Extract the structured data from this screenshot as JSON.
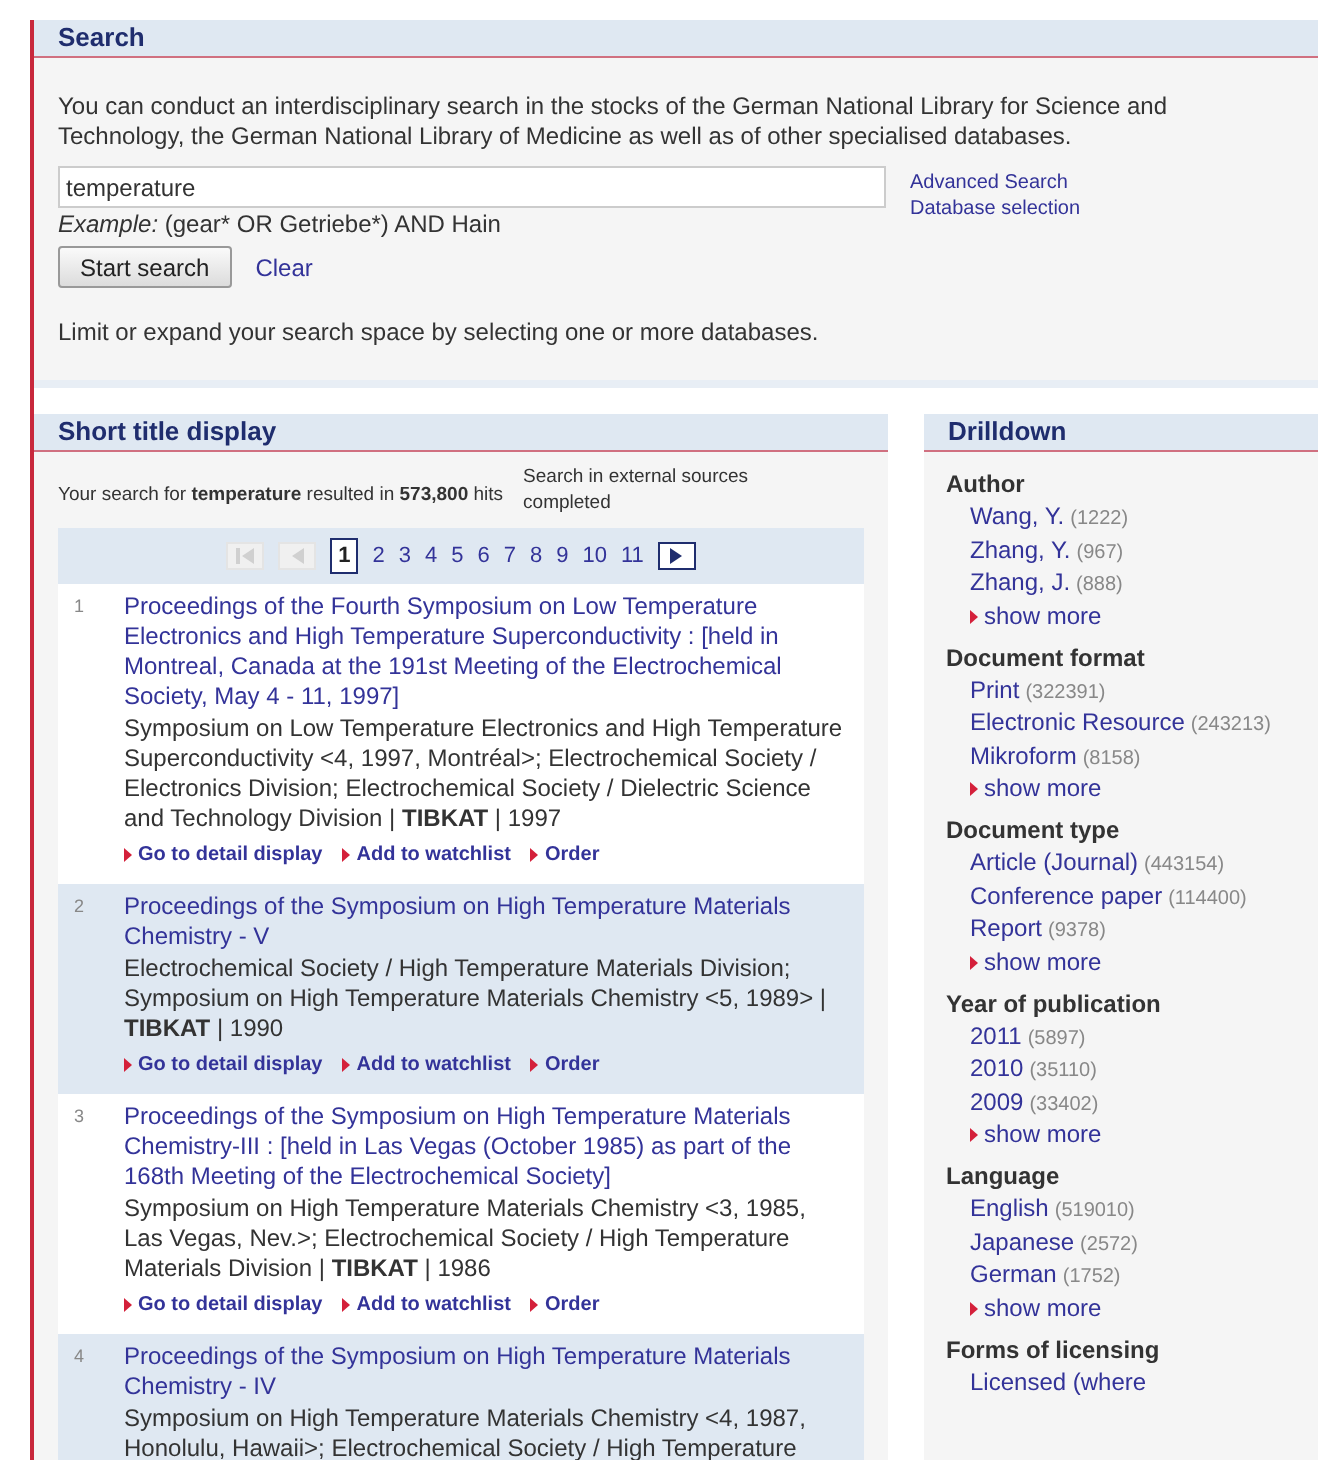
{
  "search": {
    "title": "Search",
    "intro": "You can conduct an interdisciplinary search in the stocks of the German National Library for Science and Technology, the German National Library of Medicine as well as of other specialised databases.",
    "query": "temperature",
    "example_label": "Example:",
    "example": "(gear* OR Getriebe*) AND Hain",
    "links": [
      "Advanced Search",
      "Database selection"
    ],
    "start_button": "Start search",
    "clear": "Clear",
    "hint": "Limit or expand your search space by selecting one or more databases."
  },
  "results": {
    "title": "Short title display",
    "summary": "Your search for **temperature** resulted in **573,800** hits",
    "external": "Search in external sources completed",
    "pagination": {
      "first_disabled": true,
      "prev_disabled": true,
      "pages": [
        {
          "label": "1",
          "selected": true
        },
        {
          "label": "2",
          "selected": false
        },
        {
          "label": "3",
          "selected": false
        },
        {
          "label": "4",
          "selected": false
        },
        {
          "label": "5",
          "selected": false
        },
        {
          "label": "6",
          "selected": false
        },
        {
          "label": "7",
          "selected": false
        },
        {
          "label": "8",
          "selected": false
        },
        {
          "label": "9",
          "selected": false
        },
        {
          "label": "10",
          "selected": false
        },
        {
          "label": "11",
          "selected": false
        }
      ],
      "next_disabled": false
    },
    "items": [
      {
        "number": "1",
        "shaded": false,
        "title": "Proceedings of the Fourth Symposium on Low Temperature Electronics and High Temperature Superconductivity : [held in Montreal, Canada at the 191st Meeting of the Electrochemical Society, May 4 - 11, 1997]",
        "body": "Symposium on Low Temperature Electronics and High Temperature Superconductivity <4, 1997, Montréal>; Electrochemical Society / Electronics Division; Electrochemical Society / Dielectric Science and Technology Division | **TIBKAT** | 1997",
        "actions": [
          "Go to detail display",
          "Add to watchlist",
          "Order"
        ]
      },
      {
        "number": "2",
        "shaded": true,
        "title": "Proceedings of the Symposium on High Temperature Materials Chemistry - V",
        "body": "Electrochemical Society / High Temperature Materials Division; Symposium on High Temperature Materials Chemistry <5, 1989> | **TIBKAT** | 1990",
        "actions": [
          "Go to detail display",
          "Add to watchlist",
          "Order"
        ]
      },
      {
        "number": "3",
        "shaded": false,
        "title": "Proceedings of the Symposium on High Temperature Materials Chemistry-III : [held in Las Vegas (October 1985) as part of the 168th Meeting of the Electrochemical Society]",
        "body": "Symposium on High Temperature Materials Chemistry <3, 1985, Las Vegas, Nev.>; Electrochemical Society / High Temperature Materials Division | **TIBKAT** | 1986",
        "actions": [
          "Go to detail display",
          "Add to watchlist",
          "Order"
        ]
      },
      {
        "number": "4",
        "shaded": true,
        "title": "Proceedings of the Symposium on High Temperature Materials Chemistry - IV",
        "body": "Symposium on High Temperature Materials Chemistry <4, 1987, Honolulu, Hawaii>; Electrochemical Society / High Temperature"
      }
    ]
  },
  "drilldown": {
    "title": "Drilldown",
    "groups": [
      {
        "heading": "Author",
        "items": [
          {
            "label": "Wang, Y.",
            "count": "(1222)"
          },
          {
            "label": "Zhang, Y.",
            "count": "(967)"
          },
          {
            "label": "Zhang, J.",
            "count": "(888)"
          }
        ],
        "more": "show more"
      },
      {
        "heading": "Document format",
        "items": [
          {
            "label": "Print",
            "count": "(322391)"
          },
          {
            "label": "Electronic Resource",
            "count": "(243213)"
          },
          {
            "label": "Mikroform",
            "count": "(8158)"
          }
        ],
        "more": "show more"
      },
      {
        "heading": "Document type",
        "items": [
          {
            "label": "Article (Journal)",
            "count": "(443154)"
          },
          {
            "label": "Conference paper",
            "count": "(114400)"
          },
          {
            "label": "Report",
            "count": "(9378)"
          }
        ],
        "more": "show more"
      },
      {
        "heading": "Year of publication",
        "items": [
          {
            "label": "2011",
            "count": "(5897)"
          },
          {
            "label": "2010",
            "count": "(35110)"
          },
          {
            "label": "2009",
            "count": "(33402)"
          }
        ],
        "more": "show more"
      },
      {
        "heading": "Language",
        "items": [
          {
            "label": "English",
            "count": "(519010)"
          },
          {
            "label": "Japanese",
            "count": "(2572)"
          },
          {
            "label": "German",
            "count": "(1752)"
          }
        ],
        "more": "show more"
      },
      {
        "heading": "Forms of licensing",
        "items": [
          {
            "label": "Licensed (where"
          }
        ]
      }
    ]
  }
}
